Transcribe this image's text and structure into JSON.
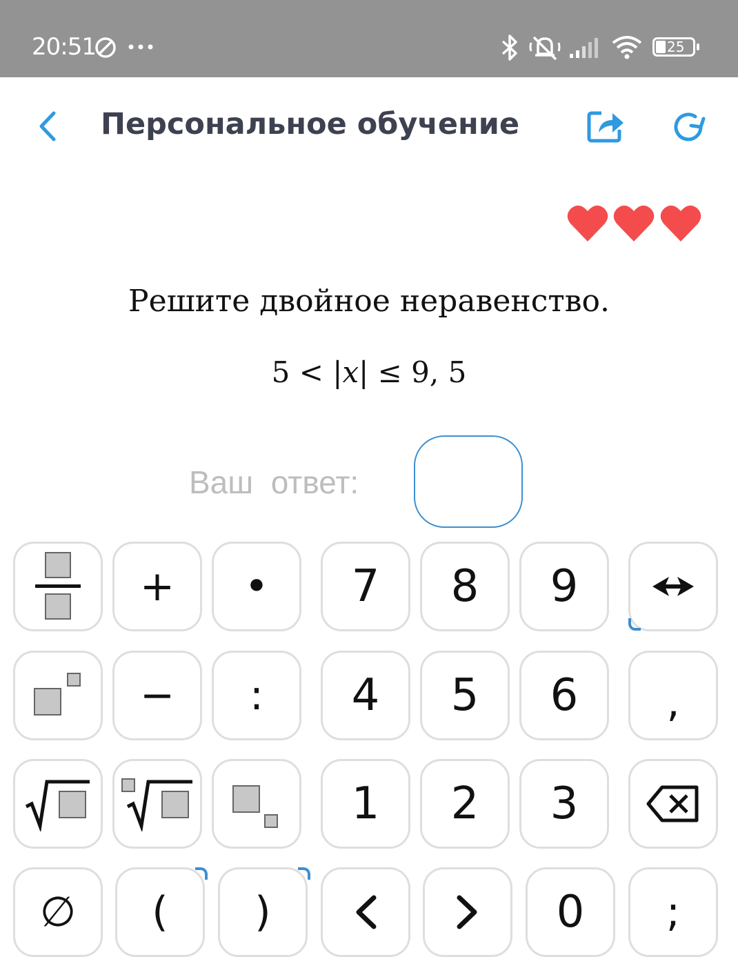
{
  "status_bar": {
    "time": "20:51",
    "battery": "25",
    "icons": [
      "do-not-disturb-icon",
      "more-dots-icon",
      "bluetooth-icon",
      "mute-icon",
      "signal-icon",
      "wifi-icon",
      "battery-icon"
    ]
  },
  "header": {
    "title": "Персональное обучение",
    "back_icon": "chevron-left-icon",
    "share_icon": "share-icon",
    "refresh_icon": "refresh-icon"
  },
  "lives": {
    "hearts": 3,
    "color": "#f44c4c"
  },
  "task": {
    "question": "Решите двойное неравенство.",
    "formula_left": "5 < |",
    "formula_var": "x",
    "formula_right": "| ≤ 9, 5"
  },
  "answer": {
    "label": "Ваш  ответ:",
    "value": ""
  },
  "keypad": {
    "row1": [
      "fraction",
      "+",
      "•",
      "7",
      "8",
      "9",
      "cursor-move"
    ],
    "row2": [
      "power",
      "−",
      ":",
      "4",
      "5",
      "6",
      ","
    ],
    "row3": [
      "sqrt",
      "nth-root",
      "subscript",
      "1",
      "2",
      "3",
      "backspace"
    ],
    "row4": [
      "∅",
      "(",
      ")",
      "<",
      ">",
      "0",
      ";"
    ]
  },
  "colors": {
    "accent": "#3d8fd1",
    "statusbar": "#939393",
    "title": "#3d4150"
  }
}
